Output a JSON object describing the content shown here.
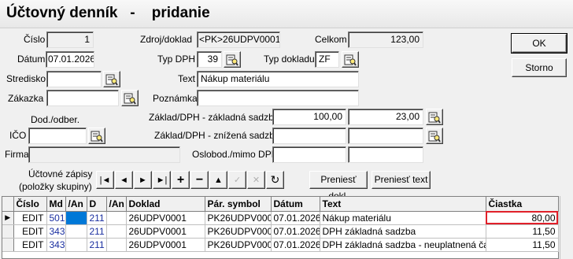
{
  "window": {
    "title": "Účtovný denník   -    pridanie"
  },
  "form": {
    "cislo": {
      "label": "Číslo",
      "value": "1"
    },
    "datum": {
      "label": "Dátum",
      "value": "07.01.2026"
    },
    "stredisko": {
      "label": "Stredisko",
      "value": ""
    },
    "zakazka": {
      "label": "Zákazka",
      "value": ""
    },
    "dod_odber": {
      "label": "Dod./odber."
    },
    "ico": {
      "label": "IČO",
      "value": ""
    },
    "firma": {
      "label": "Firma",
      "value": ""
    },
    "zdroj_doklad": {
      "label": "Zdroj/doklad",
      "value": "<PK>26UDPV0001"
    },
    "typ_dph": {
      "label": "Typ DPH",
      "value": "39"
    },
    "text": {
      "label": "Text",
      "value": "Nákup materiálu"
    },
    "poznamka": {
      "label": "Poznámka",
      "value": ""
    },
    "celkom": {
      "label": "Celkom",
      "value": "123,00"
    },
    "typ_dokladu": {
      "label": "Typ dokladu",
      "value": "ZF"
    },
    "zaklad_zakladna": {
      "label": "Základ/DPH - základná sadzba",
      "zaklad": "100,00",
      "dph": "23,00"
    },
    "zaklad_znizena": {
      "label": "Základ/DPH - znížená sadzba",
      "zaklad": "",
      "dph": ""
    },
    "oslobod": {
      "label": "Oslobod./mimo DPH",
      "value": ""
    }
  },
  "buttons": {
    "ok": "OK",
    "storno": "Storno",
    "preniest_dokl": "Preniesť dokl.",
    "preniest_text": "Preniesť text"
  },
  "section": {
    "line1": "Účtovné zápisy",
    "line2": "(položky skupiny)"
  },
  "nav": [
    "first",
    "prev",
    "next",
    "last",
    "add",
    "delete",
    "up",
    "confirm",
    "cancel",
    "refresh"
  ],
  "grid": {
    "columns": [
      "Číslo",
      "Md",
      "/An",
      "D",
      "/An",
      "Doklad",
      "Pár. symbol",
      "Dátum",
      "Text",
      "Čiastka"
    ],
    "rows": [
      {
        "cislo": "EDIT",
        "md": "501",
        "an1": "",
        "d": "211",
        "an2": "",
        "doklad": "26UDPV0001",
        "par": "PK26UDPV0001",
        "datum": "07.01.2026",
        "text": "Nákup materiálu",
        "ciastka": "80,00"
      },
      {
        "cislo": "EDIT",
        "md": "343",
        "an1": "",
        "d": "211",
        "an2": "",
        "doklad": "26UDPV0001",
        "par": "PK26UDPV0001",
        "datum": "07.01.2026",
        "text": "DPH základná sadzba",
        "ciastka": "11,50"
      },
      {
        "cislo": "EDIT",
        "md": "343",
        "an1": "",
        "d": "211",
        "an2": "",
        "doklad": "26UDPV0001",
        "par": "PK26UDPV0001",
        "datum": "07.01.2026",
        "text": "DPH základná sadzba - neuplatnená časť",
        "ciastka": "11,50"
      }
    ]
  }
}
